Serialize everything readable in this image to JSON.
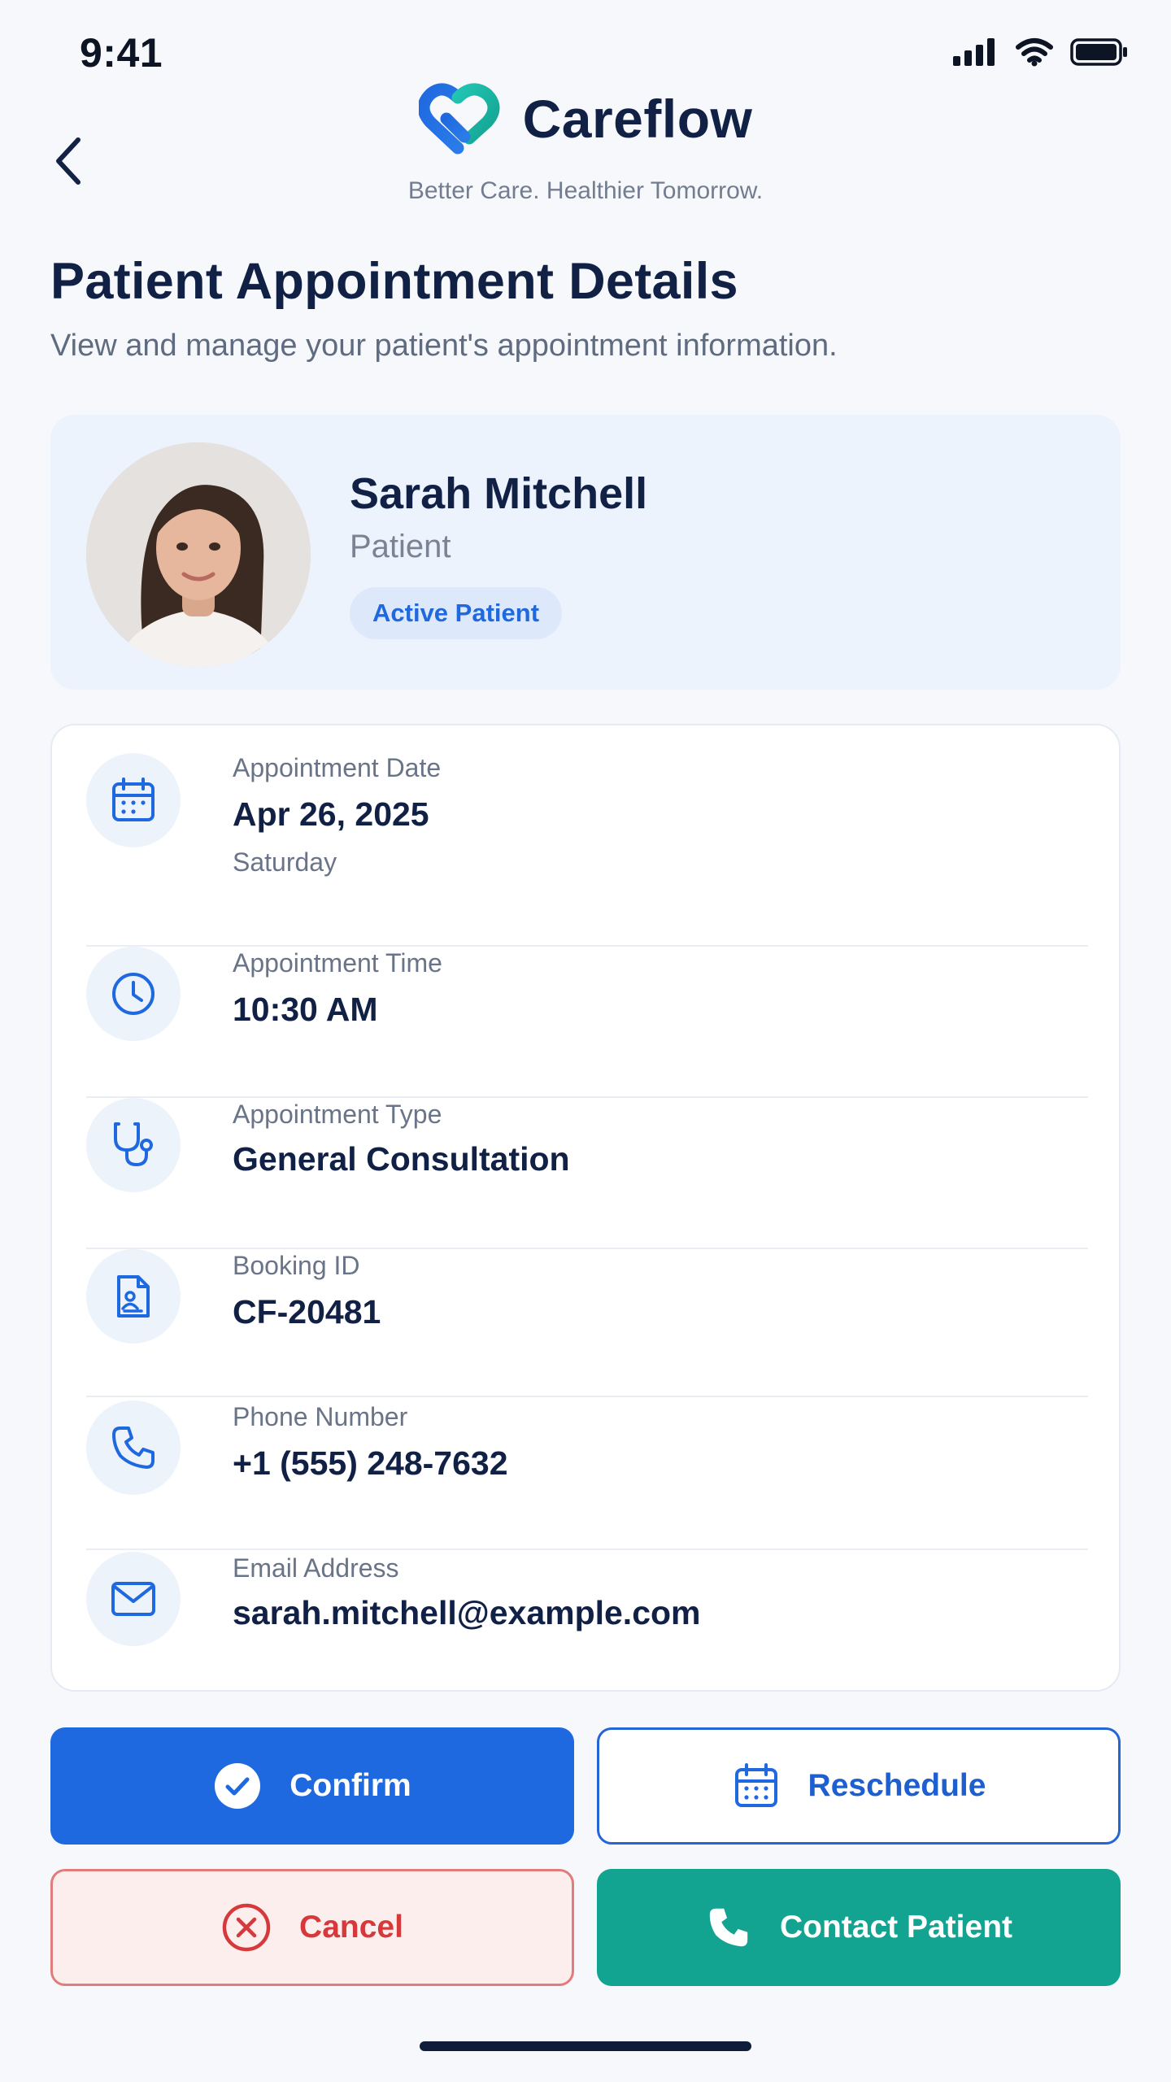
{
  "status_bar": {
    "time": "9:41",
    "icons": [
      "signal-icon",
      "wifi-icon",
      "battery-icon"
    ]
  },
  "header": {
    "back_icon": "chevron-left-icon",
    "brand_name": "Careflow",
    "tagline": "Better Care. Healthier Tomorrow."
  },
  "page": {
    "title": "Patient Appointment Details",
    "subtitle": "View and manage your patient's appointment information."
  },
  "patient": {
    "name": "Sarah Mitchell",
    "role": "Patient",
    "status": "Active Patient"
  },
  "details": [
    {
      "icon": "calendar-icon",
      "label": "Appointment Date",
      "value": "Apr 26, 2025",
      "sub": "Saturday"
    },
    {
      "icon": "clock-icon",
      "label": "Appointment Time",
      "value": "10:30 AM"
    },
    {
      "icon": "stethoscope-icon",
      "label": "Appointment Type",
      "value": "General Consultation"
    },
    {
      "icon": "id-document-icon",
      "label": "Booking ID",
      "value": "CF-20481"
    },
    {
      "icon": "phone-icon",
      "label": "Phone Number",
      "value": "+1 (555) 248-7632"
    },
    {
      "icon": "mail-icon",
      "label": "Email Address",
      "value": "sarah.mitchell@example.com"
    }
  ],
  "actions": {
    "confirm": "Confirm",
    "reschedule": "Reschedule",
    "cancel": "Cancel",
    "contact": "Contact Patient"
  },
  "colors": {
    "primary": "#1f69e0",
    "teal": "#13a391",
    "danger": "#d6393b",
    "navy": "#112045",
    "background": "#f6f8fc",
    "card_tint": "#edf3fd"
  }
}
